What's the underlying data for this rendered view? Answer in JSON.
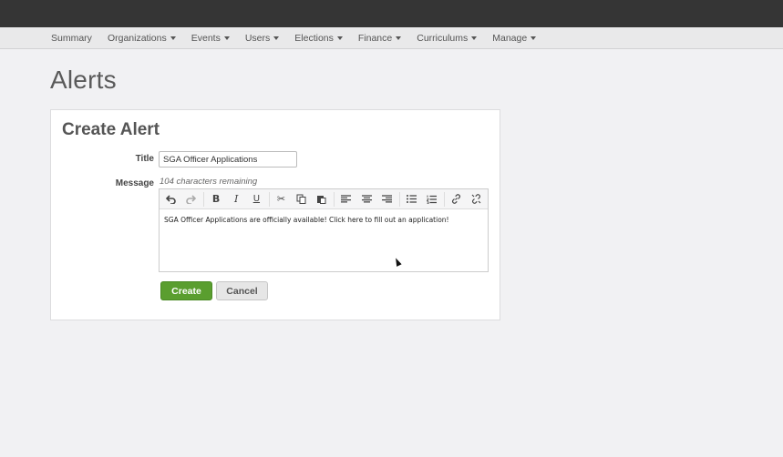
{
  "nav": {
    "items": [
      {
        "label": "Summary",
        "dropdown": false
      },
      {
        "label": "Organizations",
        "dropdown": true
      },
      {
        "label": "Events",
        "dropdown": true
      },
      {
        "label": "Users",
        "dropdown": true
      },
      {
        "label": "Elections",
        "dropdown": true
      },
      {
        "label": "Finance",
        "dropdown": true
      },
      {
        "label": "Curriculums",
        "dropdown": true
      },
      {
        "label": "Manage",
        "dropdown": true
      }
    ]
  },
  "page": {
    "title": "Alerts"
  },
  "form": {
    "heading": "Create Alert",
    "title_label": "Title",
    "title_value": "SGA Officer Applications",
    "message_label": "Message",
    "remaining": "104 characters remaining",
    "message_text": "SGA Officer Applications are officially available! Click here to fill out an application!",
    "create_label": "Create",
    "cancel_label": "Cancel"
  },
  "toolbar": {
    "icons": [
      "undo-icon",
      "redo-icon",
      "bold-icon",
      "italic-icon",
      "underline-icon",
      "cut-icon",
      "copy-icon",
      "paste-icon",
      "align-left-icon",
      "align-center-icon",
      "align-right-icon",
      "bullet-list-icon",
      "numbered-list-icon",
      "link-icon",
      "unlink-icon"
    ]
  },
  "colors": {
    "topbar": "#353535",
    "create_button": "#5a9e2f",
    "background": "#f1f1f3"
  }
}
